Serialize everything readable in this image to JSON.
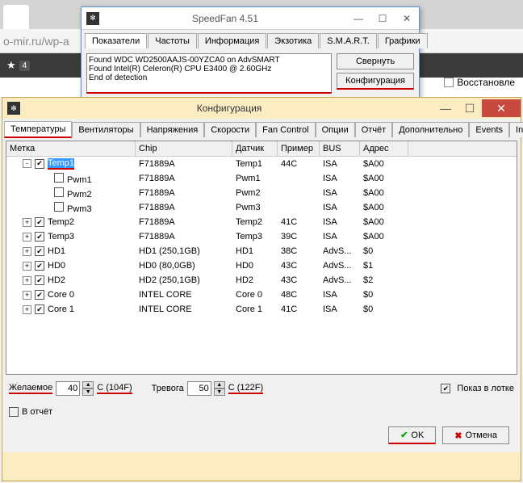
{
  "chrome": {
    "addr_fragment": "o-mir.ru/wp-a",
    "bookmark_count": "4",
    "restore_label": "Восстановле"
  },
  "speedfan": {
    "title": "SpeedFan 4.51",
    "tabs": [
      "Показатели",
      "Частоты",
      "Информация",
      "Экзотика",
      "S.M.A.R.T.",
      "Графики"
    ],
    "log": "Found WDC WD2500AAJS-00YZCA0 on AdvSMART\nFound Intel(R) Celeron(R) CPU E3400 @ 2.60GHz\nEnd of detection",
    "btn_minimize": "Свернуть",
    "btn_config": "Конфигурация"
  },
  "config": {
    "title": "Конфигурация",
    "tabs": [
      "Температуры",
      "Вентиляторы",
      "Напряжения",
      "Скорости",
      "Fan Control",
      "Опции",
      "Отчёт",
      "Дополнительно",
      "Events",
      "In"
    ],
    "active_tab": 0,
    "columns": {
      "label": "Метка",
      "chip": "Chip",
      "sensor": "Датчик",
      "sample": "Пример",
      "bus": "BUS",
      "addr": "Адрес"
    },
    "rows": [
      {
        "indent": 1,
        "toggle": "-",
        "checked": true,
        "label": "Temp1",
        "selected": true,
        "underline": true,
        "chip": "F71889A",
        "sensor": "Temp1",
        "sample": "44C",
        "bus": "ISA",
        "addr": "$A00"
      },
      {
        "indent": 2,
        "toggle": "",
        "checked": false,
        "label": "Pwm1",
        "chip": "F71889A",
        "sensor": "Pwm1",
        "sample": "",
        "bus": "ISA",
        "addr": "$A00"
      },
      {
        "indent": 2,
        "toggle": "",
        "checked": false,
        "label": "Pwm2",
        "chip": "F71889A",
        "sensor": "Pwm2",
        "sample": "",
        "bus": "ISA",
        "addr": "$A00"
      },
      {
        "indent": 2,
        "toggle": "",
        "checked": false,
        "label": "Pwm3",
        "chip": "F71889A",
        "sensor": "Pwm3",
        "sample": "",
        "bus": "ISA",
        "addr": "$A00"
      },
      {
        "indent": 1,
        "toggle": "+",
        "checked": true,
        "label": "Temp2",
        "chip": "F71889A",
        "sensor": "Temp2",
        "sample": "41C",
        "bus": "ISA",
        "addr": "$A00"
      },
      {
        "indent": 1,
        "toggle": "+",
        "checked": true,
        "label": "Temp3",
        "chip": "F71889A",
        "sensor": "Temp3",
        "sample": "39C",
        "bus": "ISA",
        "addr": "$A00"
      },
      {
        "indent": 1,
        "toggle": "+",
        "checked": true,
        "label": "HD1",
        "chip": "HD1 (250,1GB)",
        "sensor": "HD1",
        "sample": "38C",
        "bus": "AdvS...",
        "addr": "$0"
      },
      {
        "indent": 1,
        "toggle": "+",
        "checked": true,
        "label": "HD0",
        "chip": "HD0 (80,0GB)",
        "sensor": "HD0",
        "sample": "43C",
        "bus": "AdvS...",
        "addr": "$1"
      },
      {
        "indent": 1,
        "toggle": "+",
        "checked": true,
        "label": "HD2",
        "chip": "HD2 (250,1GB)",
        "sensor": "HD2",
        "sample": "43C",
        "bus": "AdvS...",
        "addr": "$2"
      },
      {
        "indent": 1,
        "toggle": "+",
        "checked": true,
        "label": "Core 0",
        "chip": "INTEL CORE",
        "sensor": "Core 0",
        "sample": "48C",
        "bus": "ISA",
        "addr": "$0"
      },
      {
        "indent": 1,
        "toggle": "+",
        "checked": true,
        "label": "Core 1",
        "chip": "INTEL CORE",
        "sensor": "Core 1",
        "sample": "41C",
        "bus": "ISA",
        "addr": "$0"
      }
    ],
    "desired": {
      "label": "Желаемое",
      "value": "40",
      "suffix": "C (104F)"
    },
    "alarm": {
      "label": "Тревога",
      "value": "50",
      "suffix": "C (122F)"
    },
    "tray_label": "Показ в лотке",
    "report_label": "В отчёт",
    "ok_label": "OK",
    "cancel_label": "Отмена"
  }
}
